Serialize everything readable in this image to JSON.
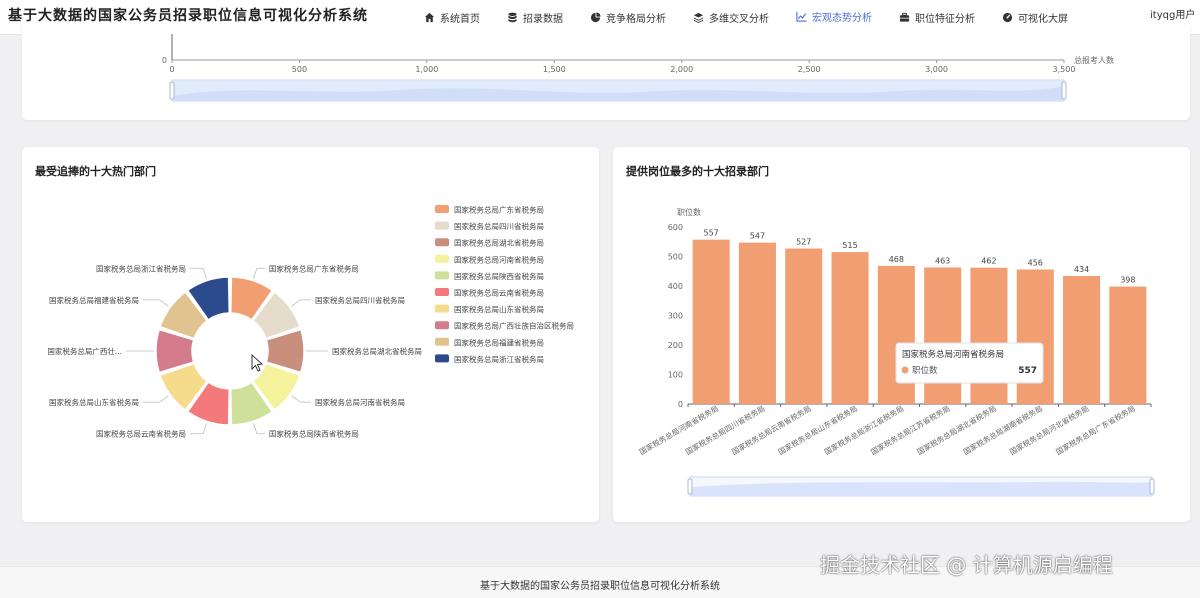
{
  "app": {
    "title": "基于大数据的国家公务员招录职位信息可视化分析系统"
  },
  "nav": [
    {
      "label": "系统首页",
      "icon": "home-icon"
    },
    {
      "label": "招录数据",
      "icon": "database-icon"
    },
    {
      "label": "竞争格局分析",
      "icon": "pie-chart-icon"
    },
    {
      "label": "多维交叉分析",
      "icon": "layers-icon"
    },
    {
      "label": "宏观态势分析",
      "icon": "line-chart-icon",
      "active": true
    },
    {
      "label": "职位特征分析",
      "icon": "briefcase-icon"
    },
    {
      "label": "可视化大屏",
      "icon": "dashboard-icon"
    }
  ],
  "user": {
    "name": "ityqg用户"
  },
  "top_card": {
    "y_tick": "0",
    "x_ticks": [
      "0",
      "500",
      "1,000",
      "1,500",
      "2,000",
      "2,500",
      "3,000",
      "3,500"
    ],
    "x_axis_name": "总报考人数"
  },
  "left_card": {
    "title": "最受追捧的十大热门部门"
  },
  "right_card": {
    "title": "提供岗位最多的十大招录部门",
    "tooltip": {
      "title": "国家税务总局河南省税务局",
      "series": "职位数",
      "value": "557"
    }
  },
  "footer": {
    "text": "基于大数据的国家公务员招录职位信息可视化分析系统"
  },
  "watermark": {
    "text": "掘金技术社区 @ 计算机源启编程"
  },
  "chart_data": [
    {
      "type": "pie",
      "title": "最受追捧的十大热门部门",
      "labels": [
        "国家税务总局广东省税务局",
        "国家税务总局四川省税务局",
        "国家税务总局湖北省税务局",
        "国家税务总局河南省税务局",
        "国家税务总局陕西省税务局",
        "国家税务总局云南省税务局",
        "国家税务总局山东省税务局",
        "国家税务总局广西壮族自治区税务局",
        "国家税务总局福建省税务局",
        "国家税务总局浙江省税务局"
      ],
      "callout_labels": [
        "国家税务总局广东省税务局",
        "国家税务总局四川省税务局",
        "国家税务总局湖北省税务局",
        "国家税务总局河南省税务局",
        "国家税务总局陕西省税务局",
        "国家税务总局云南省税务局",
        "国家税务总局山东省税务局",
        "国家税务总局广西壮...",
        "国家税务总局福建省税务局",
        "国家税务总局浙江省税务局"
      ],
      "values": [
        1,
        1,
        1,
        1,
        1,
        1,
        1,
        1,
        1,
        1
      ],
      "colors": [
        "#f29e73",
        "#e6dccc",
        "#c98e7c",
        "#f4f29b",
        "#cfe09a",
        "#f3797a",
        "#f6db8c",
        "#d47c8c",
        "#e0c38e",
        "#2b4b8c"
      ],
      "legend_position": "top-right"
    },
    {
      "type": "bar",
      "title": "提供岗位最多的十大招录部门",
      "ylabel": "职位数",
      "ylim": [
        0,
        600
      ],
      "yticks": [
        0,
        100,
        200,
        300,
        400,
        500,
        600
      ],
      "categories": [
        "国家税务总局河南省税务局",
        "国家税务总局四川省税务局",
        "国家税务总局云南省税务局",
        "国家税务总局山东省税务局",
        "国家税务总局浙江省税务局",
        "国家税务总局江苏省税务局",
        "国家税务总局湖北省税务局",
        "国家税务总局湖南省税务局",
        "国家税务总局河北省税务局",
        "国家税务总局广东省税务局"
      ],
      "values": [
        557,
        547,
        527,
        515,
        468,
        463,
        462,
        456,
        434,
        398
      ],
      "color": "#f29e73",
      "grid": false
    }
  ]
}
